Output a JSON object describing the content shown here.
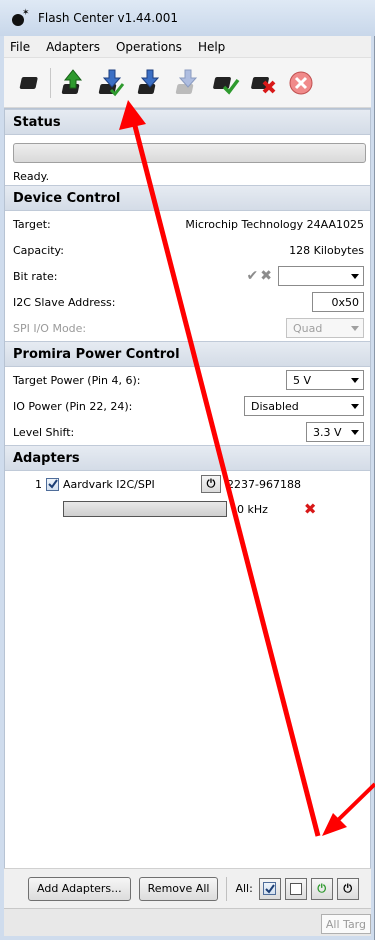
{
  "window": {
    "title": "Flash Center v1.44.001"
  },
  "menu": {
    "items": [
      "File",
      "Adapters",
      "Operations",
      "Help"
    ]
  },
  "status": {
    "header": "Status",
    "text": "Ready."
  },
  "device_control": {
    "header": "Device Control",
    "target_label": "Target:",
    "target_value": "Microchip Technology 24AA1025",
    "capacity_label": "Capacity:",
    "capacity_value": "128 Kilobytes",
    "bitrate_label": "Bit rate:",
    "bitrate_value": "",
    "i2c_label": "I2C Slave Address:",
    "i2c_value": "0x50",
    "spi_label": "SPI I/O Mode:",
    "spi_value": "Quad"
  },
  "power_control": {
    "header": "Promira Power Control",
    "target_power_label": "Target Power (Pin 4, 6):",
    "target_power_value": "5 V",
    "io_power_label": "IO Power (Pin 22, 24):",
    "io_power_value": "Disabled",
    "level_shift_label": "Level Shift:",
    "level_shift_value": "3.3 V"
  },
  "adapters": {
    "header": "Adapters",
    "items": [
      {
        "index": "1",
        "name": "Aardvark I2C/SPI",
        "serial": "2237-967188",
        "freq": "0 kHz"
      }
    ]
  },
  "bottom": {
    "add_label": "Add Adapters...",
    "remove_label": "Remove All",
    "all_label": "All:"
  },
  "statusbar": {
    "field": "All Targ"
  },
  "colors": {
    "accent_blue": "#3b6fc4",
    "green": "#2e9a2e",
    "red_arrow": "#ff0000"
  }
}
